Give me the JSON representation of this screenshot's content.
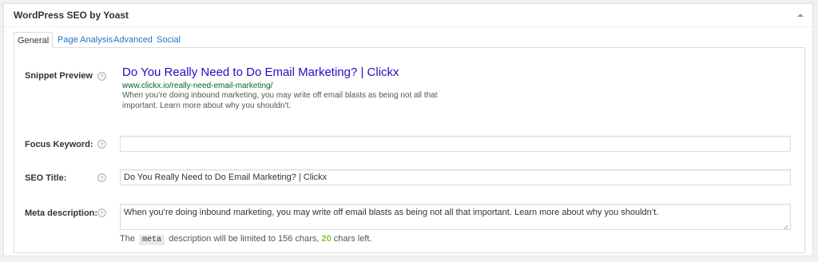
{
  "metabox": {
    "title": "WordPress SEO by Yoast",
    "toggle_icon": "triangle-up-icon"
  },
  "tabs": [
    {
      "label": "General",
      "active": true
    },
    {
      "label": "Page Analysis",
      "active": false
    },
    {
      "label": "Advanced",
      "active": false
    },
    {
      "label": "Social",
      "active": false
    }
  ],
  "snippet": {
    "label": "Snippet Preview",
    "title": "Do You Really Need to Do Email Marketing? | Clickx",
    "url": "www.clickx.io/really-need-email-marketing/",
    "description": "When you’re doing inbound marketing, you may write off email blasts as being not all that important. Learn more about why you shouldn’t."
  },
  "focus_keyword": {
    "label": "Focus Keyword:",
    "value": ""
  },
  "seo_title": {
    "label": "SEO Title:",
    "value": "Do You Really Need to Do Email Marketing? | Clickx"
  },
  "meta_description": {
    "label": "Meta description:",
    "value": "When you’re doing inbound marketing, you may write off email blasts as being not all that important. Learn more about why you shouldn’t.",
    "counter_prefix": "The",
    "counter_code": "meta",
    "counter_middle": "description will be limited to 156 chars,",
    "counter_left": "20",
    "counter_suffix": "chars left."
  },
  "help_icon": "question-circle-icon",
  "colors": {
    "link": "#2276c2",
    "snippet_title": "#1e0fbe",
    "snippet_url": "#006621",
    "chars_left": "#7ad03a"
  }
}
